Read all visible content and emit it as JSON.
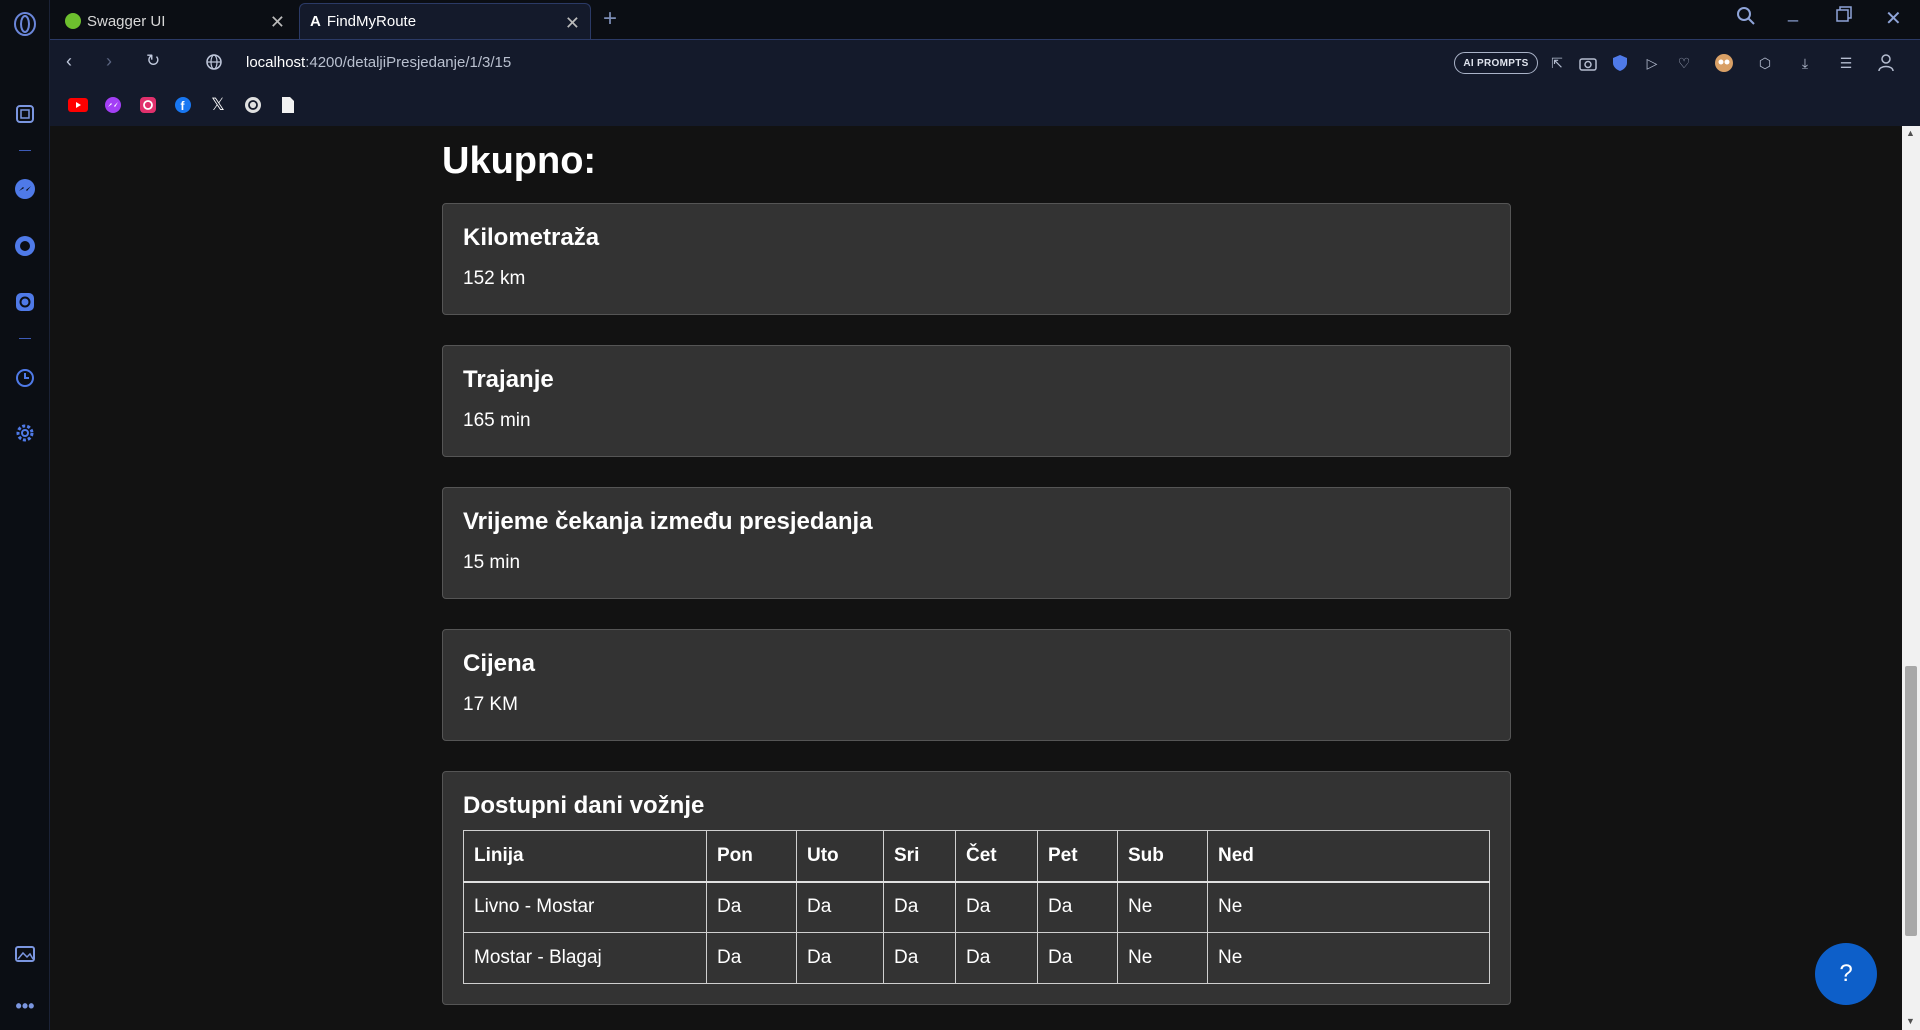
{
  "tabs": [
    {
      "label": "Swagger UI",
      "active": false
    },
    {
      "label": "FindMyRoute",
      "active": true
    }
  ],
  "address": {
    "host": "localhost",
    "path": ":4200/detaljiPresjedanje/1/3/15"
  },
  "toolbar": {
    "ai_prompts": "AI PROMPTS"
  },
  "page": {
    "title": "Ukupno:",
    "cards": [
      {
        "heading": "Kilometraža",
        "value": "152 km"
      },
      {
        "heading": "Trajanje",
        "value": "165 min"
      },
      {
        "heading": "Vrijeme čekanja između presjedanja",
        "value": "15 min"
      },
      {
        "heading": "Cijena",
        "value": "17 KM"
      }
    ],
    "days_card": {
      "heading": "Dostupni dani vožnje",
      "columns": [
        "Linija",
        "Pon",
        "Uto",
        "Sri",
        "Čet",
        "Pet",
        "Sub",
        "Ned"
      ],
      "rows": [
        [
          "Livno - Mostar",
          "Da",
          "Da",
          "Da",
          "Da",
          "Da",
          "Ne",
          "Ne"
        ],
        [
          "Mostar - Blagaj",
          "Da",
          "Da",
          "Da",
          "Da",
          "Da",
          "Ne",
          "Ne"
        ]
      ]
    },
    "help_label": "?"
  },
  "colors": {
    "accent": "#0d5fc9",
    "card_bg": "#333333",
    "page_bg": "#121212"
  }
}
